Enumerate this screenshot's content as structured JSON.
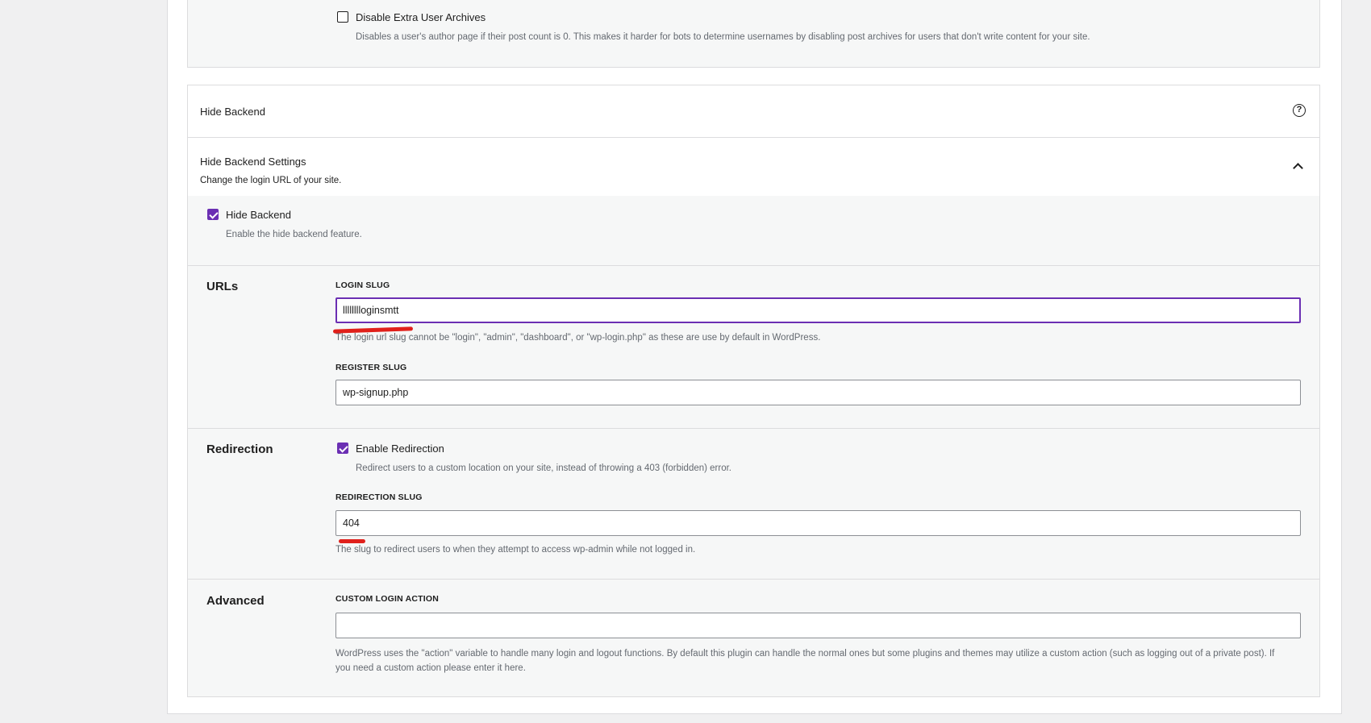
{
  "disable_archives": {
    "label": "Disable Extra User Archives",
    "description": "Disables a user's author page if their post count is 0. This makes it harder for bots to determine usernames by disabling post archives for users that don't write content for your site.",
    "checked": false
  },
  "hide_backend_panel": {
    "title": "Hide Backend",
    "help_icon": "help-circle-icon",
    "help_glyph": "?"
  },
  "settings_section": {
    "title": "Hide Backend Settings",
    "subtitle": "Change the login URL of your site.",
    "collapse_icon": "chevron-up-icon"
  },
  "hide_backend_toggle": {
    "label": "Hide Backend",
    "description": "Enable the hide backend feature.",
    "checked": true
  },
  "urls": {
    "heading": "URLs",
    "login_slug_label": "LOGIN SLUG",
    "login_slug_value": "lllllllloginsmtt",
    "login_slug_help": "The login url slug cannot be \"login\", \"admin\", \"dashboard\", or \"wp-login.php\" as these are use by default in WordPress.",
    "register_slug_label": "REGISTER SLUG",
    "register_slug_value": "wp-signup.php"
  },
  "redirection": {
    "heading": "Redirection",
    "enable_label": "Enable Redirection",
    "enable_description": "Redirect users to a custom location on your site, instead of throwing a 403 (forbidden) error.",
    "enable_checked": true,
    "slug_label": "REDIRECTION SLUG",
    "slug_value": "404",
    "slug_help": "The slug to redirect users to when they attempt to access wp-admin while not logged in."
  },
  "advanced": {
    "heading": "Advanced",
    "custom_action_label": "CUSTOM LOGIN ACTION",
    "custom_action_value": "",
    "custom_action_help": "WordPress uses the \"action\" variable to handle many login and logout functions. By default this plugin can handle the normal ones but some plugins and themes may utilize a custom action (such as logging out of a private post). If you need a custom action please enter it here."
  },
  "colors": {
    "accent": "#6b2fb3",
    "annotation": "#e0201b"
  }
}
